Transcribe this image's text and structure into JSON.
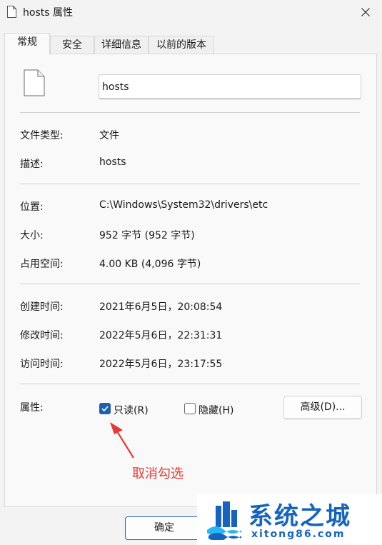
{
  "window": {
    "title": "hosts 属性",
    "close_icon": "close-icon"
  },
  "tabs": [
    {
      "label": "常规",
      "active": true
    },
    {
      "label": "安全",
      "active": false
    },
    {
      "label": "详细信息",
      "active": false
    },
    {
      "label": "以前的版本",
      "active": false
    }
  ],
  "general": {
    "file_name": "hosts",
    "file_icon": "file-icon",
    "rows": {
      "file_type": {
        "label": "文件类型:",
        "value": "文件"
      },
      "description": {
        "label": "描述:",
        "value": "hosts"
      },
      "location": {
        "label": "位置:",
        "value": "C:\\Windows\\System32\\drivers\\etc"
      },
      "size": {
        "label": "大小:",
        "value": "952 字节 (952 字节)"
      },
      "size_on_disk": {
        "label": "占用空间:",
        "value": "4.00 KB (4,096 字节)"
      },
      "created": {
        "label": "创建时间:",
        "value": "2021年6月5日，20:08:54"
      },
      "modified": {
        "label": "修改时间:",
        "value": "2022年5月6日，22:31:31"
      },
      "accessed": {
        "label": "访问时间:",
        "value": "2022年5月6日，23:17:55"
      }
    },
    "attributes": {
      "label": "属性:",
      "readonly": {
        "label": "只读(R)",
        "checked": true
      },
      "hidden": {
        "label": "隐藏(H)",
        "checked": false
      },
      "advanced_button": "高级(D)..."
    }
  },
  "footer": {
    "ok_button": "确定"
  },
  "annotation": {
    "text": "取消勾选",
    "color": "#e53935"
  },
  "watermark": {
    "brand": "系统之城",
    "url": "xitong86.com"
  },
  "colors": {
    "accent": "#1f5fb0",
    "watermark": "#1565c0"
  }
}
